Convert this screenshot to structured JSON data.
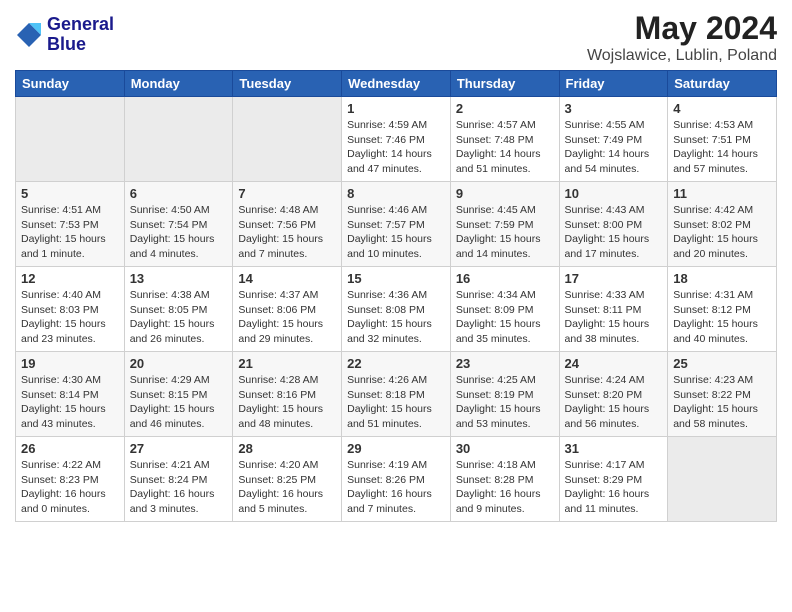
{
  "header": {
    "logo_line1": "General",
    "logo_line2": "Blue",
    "month": "May 2024",
    "location": "Wojslawice, Lublin, Poland"
  },
  "weekdays": [
    "Sunday",
    "Monday",
    "Tuesday",
    "Wednesday",
    "Thursday",
    "Friday",
    "Saturday"
  ],
  "weeks": [
    [
      {
        "day": "",
        "sunrise": "",
        "sunset": "",
        "daylight": ""
      },
      {
        "day": "",
        "sunrise": "",
        "sunset": "",
        "daylight": ""
      },
      {
        "day": "",
        "sunrise": "",
        "sunset": "",
        "daylight": ""
      },
      {
        "day": "1",
        "sunrise": "Sunrise: 4:59 AM",
        "sunset": "Sunset: 7:46 PM",
        "daylight": "Daylight: 14 hours and 47 minutes."
      },
      {
        "day": "2",
        "sunrise": "Sunrise: 4:57 AM",
        "sunset": "Sunset: 7:48 PM",
        "daylight": "Daylight: 14 hours and 51 minutes."
      },
      {
        "day": "3",
        "sunrise": "Sunrise: 4:55 AM",
        "sunset": "Sunset: 7:49 PM",
        "daylight": "Daylight: 14 hours and 54 minutes."
      },
      {
        "day": "4",
        "sunrise": "Sunrise: 4:53 AM",
        "sunset": "Sunset: 7:51 PM",
        "daylight": "Daylight: 14 hours and 57 minutes."
      }
    ],
    [
      {
        "day": "5",
        "sunrise": "Sunrise: 4:51 AM",
        "sunset": "Sunset: 7:53 PM",
        "daylight": "Daylight: 15 hours and 1 minute."
      },
      {
        "day": "6",
        "sunrise": "Sunrise: 4:50 AM",
        "sunset": "Sunset: 7:54 PM",
        "daylight": "Daylight: 15 hours and 4 minutes."
      },
      {
        "day": "7",
        "sunrise": "Sunrise: 4:48 AM",
        "sunset": "Sunset: 7:56 PM",
        "daylight": "Daylight: 15 hours and 7 minutes."
      },
      {
        "day": "8",
        "sunrise": "Sunrise: 4:46 AM",
        "sunset": "Sunset: 7:57 PM",
        "daylight": "Daylight: 15 hours and 10 minutes."
      },
      {
        "day": "9",
        "sunrise": "Sunrise: 4:45 AM",
        "sunset": "Sunset: 7:59 PM",
        "daylight": "Daylight: 15 hours and 14 minutes."
      },
      {
        "day": "10",
        "sunrise": "Sunrise: 4:43 AM",
        "sunset": "Sunset: 8:00 PM",
        "daylight": "Daylight: 15 hours and 17 minutes."
      },
      {
        "day": "11",
        "sunrise": "Sunrise: 4:42 AM",
        "sunset": "Sunset: 8:02 PM",
        "daylight": "Daylight: 15 hours and 20 minutes."
      }
    ],
    [
      {
        "day": "12",
        "sunrise": "Sunrise: 4:40 AM",
        "sunset": "Sunset: 8:03 PM",
        "daylight": "Daylight: 15 hours and 23 minutes."
      },
      {
        "day": "13",
        "sunrise": "Sunrise: 4:38 AM",
        "sunset": "Sunset: 8:05 PM",
        "daylight": "Daylight: 15 hours and 26 minutes."
      },
      {
        "day": "14",
        "sunrise": "Sunrise: 4:37 AM",
        "sunset": "Sunset: 8:06 PM",
        "daylight": "Daylight: 15 hours and 29 minutes."
      },
      {
        "day": "15",
        "sunrise": "Sunrise: 4:36 AM",
        "sunset": "Sunset: 8:08 PM",
        "daylight": "Daylight: 15 hours and 32 minutes."
      },
      {
        "day": "16",
        "sunrise": "Sunrise: 4:34 AM",
        "sunset": "Sunset: 8:09 PM",
        "daylight": "Daylight: 15 hours and 35 minutes."
      },
      {
        "day": "17",
        "sunrise": "Sunrise: 4:33 AM",
        "sunset": "Sunset: 8:11 PM",
        "daylight": "Daylight: 15 hours and 38 minutes."
      },
      {
        "day": "18",
        "sunrise": "Sunrise: 4:31 AM",
        "sunset": "Sunset: 8:12 PM",
        "daylight": "Daylight: 15 hours and 40 minutes."
      }
    ],
    [
      {
        "day": "19",
        "sunrise": "Sunrise: 4:30 AM",
        "sunset": "Sunset: 8:14 PM",
        "daylight": "Daylight: 15 hours and 43 minutes."
      },
      {
        "day": "20",
        "sunrise": "Sunrise: 4:29 AM",
        "sunset": "Sunset: 8:15 PM",
        "daylight": "Daylight: 15 hours and 46 minutes."
      },
      {
        "day": "21",
        "sunrise": "Sunrise: 4:28 AM",
        "sunset": "Sunset: 8:16 PM",
        "daylight": "Daylight: 15 hours and 48 minutes."
      },
      {
        "day": "22",
        "sunrise": "Sunrise: 4:26 AM",
        "sunset": "Sunset: 8:18 PM",
        "daylight": "Daylight: 15 hours and 51 minutes."
      },
      {
        "day": "23",
        "sunrise": "Sunrise: 4:25 AM",
        "sunset": "Sunset: 8:19 PM",
        "daylight": "Daylight: 15 hours and 53 minutes."
      },
      {
        "day": "24",
        "sunrise": "Sunrise: 4:24 AM",
        "sunset": "Sunset: 8:20 PM",
        "daylight": "Daylight: 15 hours and 56 minutes."
      },
      {
        "day": "25",
        "sunrise": "Sunrise: 4:23 AM",
        "sunset": "Sunset: 8:22 PM",
        "daylight": "Daylight: 15 hours and 58 minutes."
      }
    ],
    [
      {
        "day": "26",
        "sunrise": "Sunrise: 4:22 AM",
        "sunset": "Sunset: 8:23 PM",
        "daylight": "Daylight: 16 hours and 0 minutes."
      },
      {
        "day": "27",
        "sunrise": "Sunrise: 4:21 AM",
        "sunset": "Sunset: 8:24 PM",
        "daylight": "Daylight: 16 hours and 3 minutes."
      },
      {
        "day": "28",
        "sunrise": "Sunrise: 4:20 AM",
        "sunset": "Sunset: 8:25 PM",
        "daylight": "Daylight: 16 hours and 5 minutes."
      },
      {
        "day": "29",
        "sunrise": "Sunrise: 4:19 AM",
        "sunset": "Sunset: 8:26 PM",
        "daylight": "Daylight: 16 hours and 7 minutes."
      },
      {
        "day": "30",
        "sunrise": "Sunrise: 4:18 AM",
        "sunset": "Sunset: 8:28 PM",
        "daylight": "Daylight: 16 hours and 9 minutes."
      },
      {
        "day": "31",
        "sunrise": "Sunrise: 4:17 AM",
        "sunset": "Sunset: 8:29 PM",
        "daylight": "Daylight: 16 hours and 11 minutes."
      },
      {
        "day": "",
        "sunrise": "",
        "sunset": "",
        "daylight": ""
      }
    ]
  ]
}
